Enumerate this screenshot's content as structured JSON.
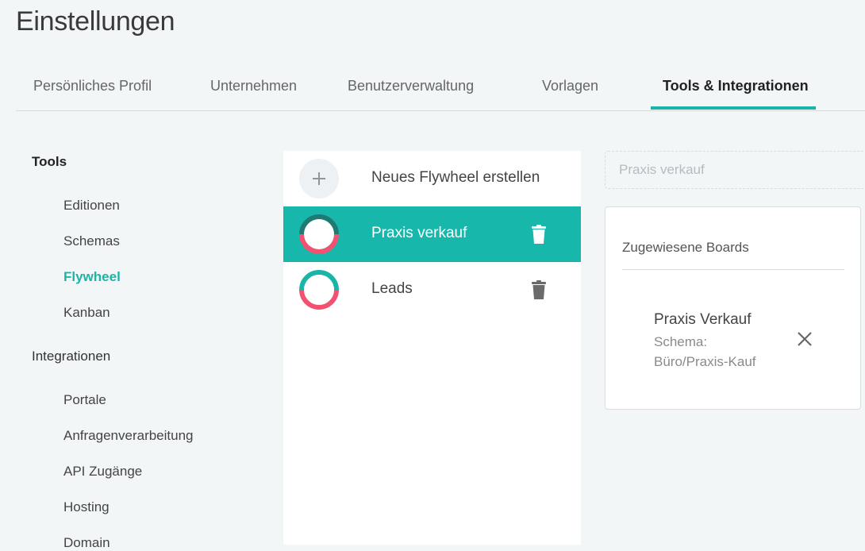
{
  "page": {
    "title": "Einstellungen"
  },
  "tabs": [
    {
      "label": "Persönliches Profil"
    },
    {
      "label": "Unternehmen"
    },
    {
      "label": "Benutzerverwaltung"
    },
    {
      "label": "Vorlagen"
    },
    {
      "label": "Tools & Integrationen",
      "active": true
    }
  ],
  "sidebar": {
    "tools_heading": "Tools",
    "tools_items": [
      {
        "label": "Editionen"
      },
      {
        "label": "Schemas"
      },
      {
        "label": "Flywheel",
        "active": true
      },
      {
        "label": "Kanban"
      }
    ],
    "integrations_heading": "Integrationen",
    "integrations_items": [
      {
        "label": "Portale"
      },
      {
        "label": "Anfragenverarbeitung"
      },
      {
        "label": "API Zugänge"
      },
      {
        "label": "Hosting"
      },
      {
        "label": "Domain"
      }
    ]
  },
  "flywheels": {
    "create_label": "Neues Flywheel erstellen",
    "items": [
      {
        "label": "Praxis verkauf",
        "selected": true
      },
      {
        "label": "Leads",
        "selected": false
      }
    ]
  },
  "detail": {
    "name_value": "Praxis verkauf",
    "assigned_title": "Zugewiesene Boards",
    "boards": [
      {
        "name": "Praxis Verkauf",
        "schema_label": "Schema:",
        "schema_value": "Büro/Praxis-Kauf"
      }
    ]
  },
  "colors": {
    "accent": "#1bb5a8",
    "selected_row": "#18b7ab",
    "ring_pink": "#f2516f",
    "ring_teal": "#1bb5a8",
    "ring_dark_teal": "#1f7a74"
  },
  "icons": {
    "add": "plus-icon",
    "delete": "trash-icon",
    "remove": "close-icon"
  }
}
